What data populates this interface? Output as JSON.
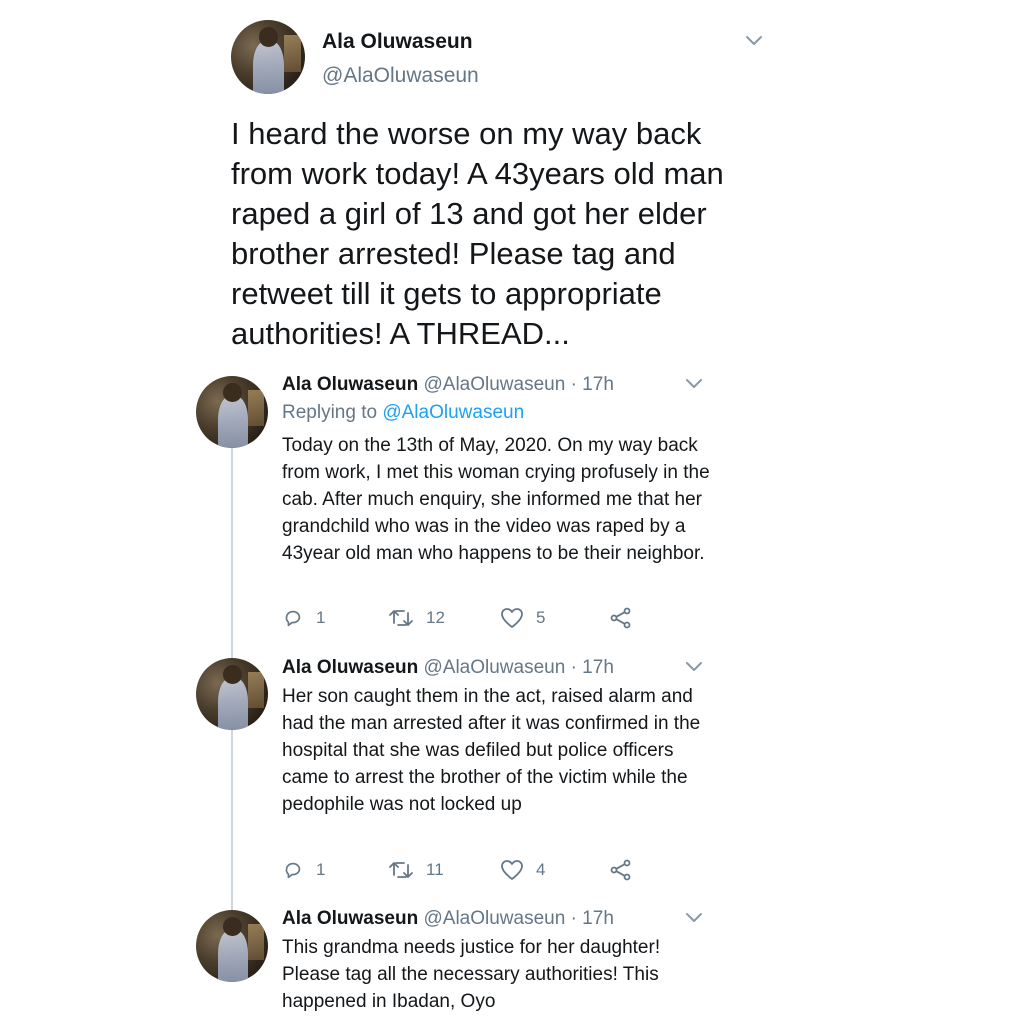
{
  "main_tweet": {
    "name": "Ala Oluwaseun",
    "handle": "@AlaOluwaseun",
    "text": "I heard the worse on my way back from work today! A 43years old man raped a girl of 13 and got her elder brother arrested! Please tag and retweet till it gets to appropriate authorities! A THREAD..."
  },
  "replies": [
    {
      "name": "Ala Oluwaseun",
      "handle": "@AlaOluwaseun",
      "time": "· 17h",
      "replying_prefix": "Replying to",
      "replying_to": "@AlaOluwaseun",
      "text": "Today on the 13th of May, 2020. On my way back from work, I met this woman crying profusely in the cab. After much enquiry, she informed me that her grandchild who was in the video was raped by a 43year old man who happens to be their neighbor.",
      "reply_count": "1",
      "retweet_count": "12",
      "like_count": "5"
    },
    {
      "name": "Ala Oluwaseun",
      "handle": "@AlaOluwaseun",
      "time": "· 17h",
      "text": "Her son caught them in the act, raised alarm and had the man arrested after it was confirmed in the hospital that she was defiled but police officers came to arrest the brother of the victim while the pedophile was not locked up",
      "reply_count": "1",
      "retweet_count": "11",
      "like_count": "4"
    },
    {
      "name": "Ala Oluwaseun",
      "handle": "@AlaOluwaseun",
      "time": "· 17h",
      "text": "This grandma needs justice for her daughter! Please tag all the necessary authorities! This happened in Ibadan, Oyo"
    }
  ],
  "icons": {
    "caret": "chevron-down-icon",
    "reply": "reply-icon",
    "retweet": "retweet-icon",
    "like": "heart-icon",
    "share": "share-icon"
  },
  "colors": {
    "text": "#14171a",
    "secondary": "#657786",
    "link": "#1da1f2",
    "thread_line": "#ccd6dd"
  }
}
